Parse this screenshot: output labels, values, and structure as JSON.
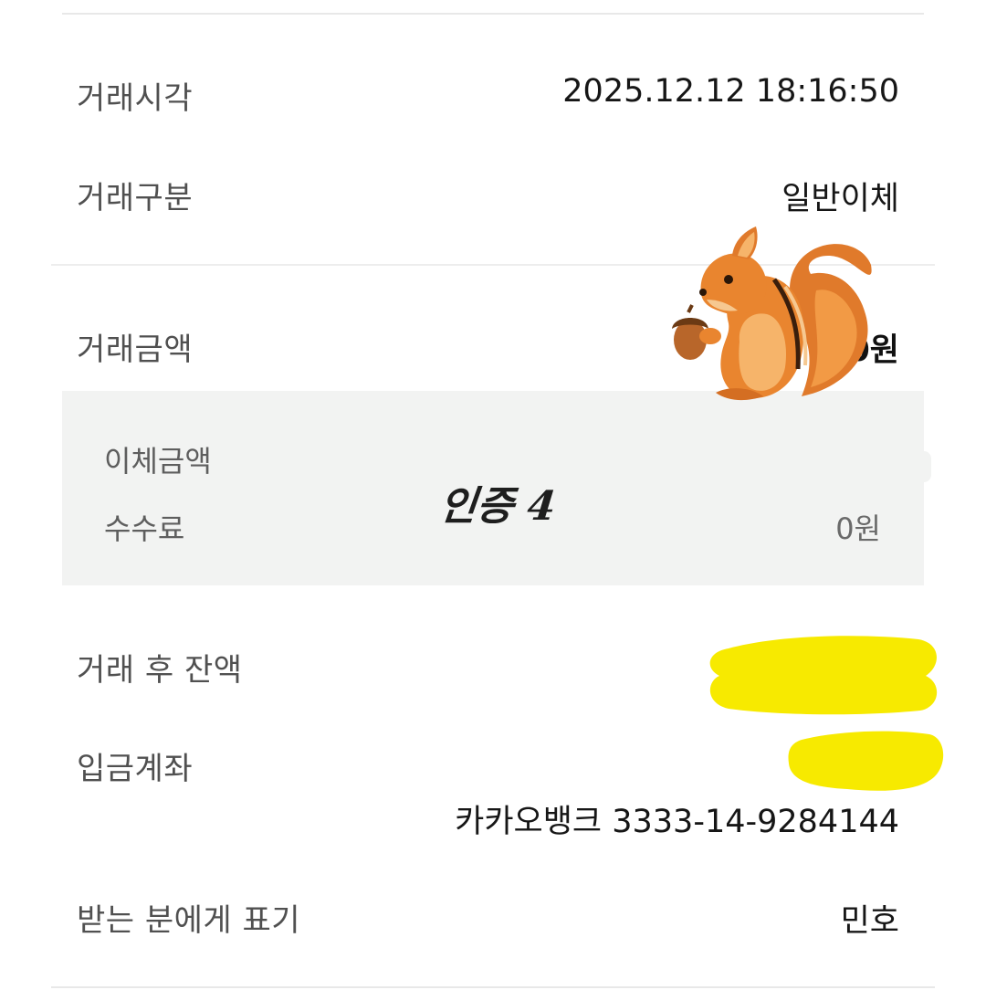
{
  "rows": {
    "time": {
      "label": "거래시각",
      "value": "2025.12.12 18:16:50"
    },
    "type": {
      "label": "거래구분",
      "value": "일반이체"
    },
    "amount": {
      "label": "거래금액",
      "value": "0원"
    },
    "balance": {
      "label": "거래 후 잔액"
    },
    "account": {
      "label": "입금계좌",
      "value": "카카오뱅크 3333-14-9284144"
    },
    "memo": {
      "label": "받는 분에게 표기",
      "value": "민호"
    }
  },
  "detail": {
    "transfer": {
      "label": "이체금액"
    },
    "fee": {
      "label": "수수료",
      "value": "0원"
    }
  },
  "overlay": {
    "watermark": "인증 4",
    "sticker_icon": "squirrel-emoji",
    "redaction_color": "#f7ea00"
  }
}
